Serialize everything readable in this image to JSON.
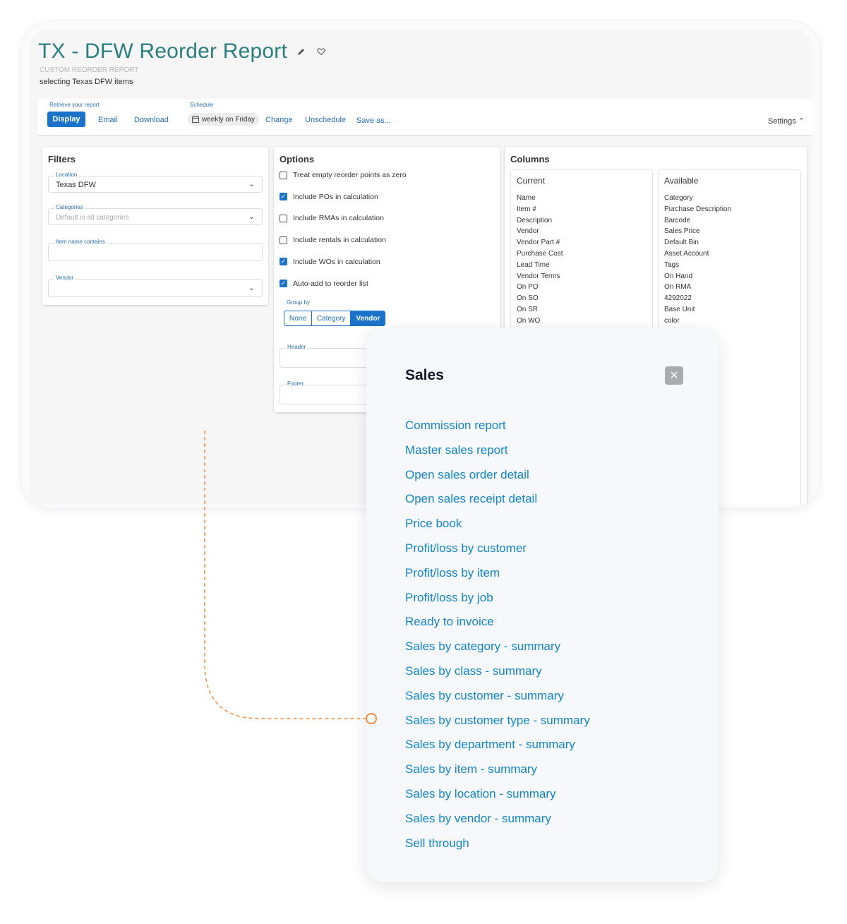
{
  "header": {
    "title": "TX - DFW Reorder Report",
    "report_type": "CUSTOM REORDER REPORT",
    "description": "selecting Texas DFW items",
    "edit_icon": "pencil-icon",
    "favorite_icon": "heart-icon"
  },
  "toolbar": {
    "retrieve_label": "Retrieve your report",
    "display": "Display",
    "email": "Email",
    "download": "Download",
    "schedule_label": "Schedule",
    "schedule_value": "weekly on Friday",
    "change": "Change",
    "unschedule": "Unschedule",
    "save_as": "Save as...",
    "settings": "Settings"
  },
  "filters": {
    "title": "Filters",
    "location_label": "Location",
    "location_value": "Texas DFW",
    "categories_label": "Categories",
    "categories_placeholder": "Default is all categories",
    "item_name_label": "Item name contains",
    "vendor_label": "Vendor"
  },
  "options": {
    "title": "Options",
    "items": [
      {
        "label": "Treat empty reorder points as zero",
        "checked": false
      },
      {
        "label": "Include POs in calculation",
        "checked": true
      },
      {
        "label": "Include RMAs in calculation",
        "checked": false
      },
      {
        "label": "Include rentals in calculation",
        "checked": false
      },
      {
        "label": "Include WOs in calculation",
        "checked": true
      },
      {
        "label": "Auto-add to reorder list",
        "checked": true
      }
    ],
    "group_by_label": "Group by",
    "group_by": [
      "None",
      "Category",
      "Vendor"
    ],
    "group_by_selected": "Vendor",
    "header_label": "Header",
    "footer_label": "Footer"
  },
  "columns": {
    "title": "Columns",
    "current_title": "Current",
    "current": [
      "Name",
      "Item #",
      "Description",
      "Vendor",
      "Vendor Part #",
      "Purchase Cost",
      "Lead Time",
      "Vendor Terms",
      "On PO",
      "On SO",
      "On SR",
      "On WO"
    ],
    "available_title": "Available",
    "available": [
      "Category",
      "Purchase Description",
      "Barcode",
      "Sales Price",
      "Default Bin",
      "Asset Account",
      "Tags",
      "On Hand",
      "On RMA",
      "4292022",
      "Base Unit",
      "color"
    ]
  },
  "sales_popup": {
    "title": "Sales",
    "close_icon": "close-icon",
    "reports": [
      "Commission report",
      "Master sales report",
      "Open sales order detail",
      "Open sales receipt detail",
      "Price book",
      "Profit/loss by customer",
      "Profit/loss by item",
      "Profit/loss by job",
      "Ready to invoice",
      "Sales by category - summary",
      "Sales by class - summary",
      "Sales by customer - summary",
      "Sales by customer type - summary",
      "Sales by department - summary",
      "Sales by item - summary",
      "Sales by location - summary",
      "Sales by vendor - summary",
      "Sell through"
    ]
  },
  "colors": {
    "title_teal": "#2a7f80",
    "link_blue": "#1185c8",
    "primary_blue": "#1a73c9",
    "connector_orange": "#f08a3c"
  }
}
